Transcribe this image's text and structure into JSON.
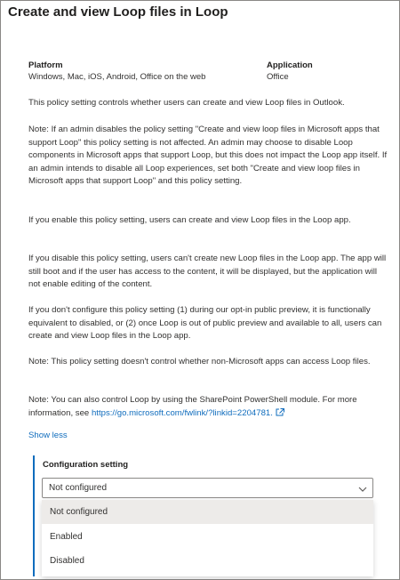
{
  "title": "Create and view Loop files in Loop",
  "meta": {
    "platform_label": "Platform",
    "platform_value": "Windows, Mac, iOS, Android, Office on the web",
    "application_label": "Application",
    "application_value": "Office"
  },
  "paragraphs": {
    "p1": "This policy setting controls whether users can create and view Loop files in Outlook.",
    "p2": "Note: If an admin disables the policy setting \"Create and view loop files in Microsoft apps that support Loop\" this policy setting is not affected. An admin may choose to disable Loop components in Microsoft apps that support Loop, but this does not impact the Loop app itself. If an admin intends to disable all Loop experiences, set both \"Create and view loop files in Microsoft apps that support Loop\" and this policy setting.",
    "p3": "If you enable this policy setting, users can create and view Loop files in the Loop app.",
    "p4": "If you disable this policy setting, users can't create new Loop files in the Loop app. The app will still boot and if the user has access to the content, it will be displayed, but the application will not enable editing of the content.",
    "p5": "If you don't configure this policy setting (1) during our opt-in public preview, it is functionally equivalent to disabled, or (2) once Loop is out of public preview and available to all, users can create and view Loop files in the Loop app.",
    "p6": "Note: This policy setting doesn't control whether non-Microsoft apps can access Loop files.",
    "p7_text": "Note: You can also control Loop by using the SharePoint PowerShell module. For more information, see ",
    "p7_link": "https://go.microsoft.com/fwlink/?linkid=2204781.",
    "p7_link_icon": "external-link-icon"
  },
  "show_less": "Show less",
  "config": {
    "label": "Configuration setting",
    "selected_value": "Not configured",
    "chevron_icon": "chevron-down-icon",
    "options": [
      "Not configured",
      "Enabled",
      "Disabled"
    ]
  },
  "colors": {
    "accent": "#0f6cbd",
    "text": "#323130",
    "selected_option_bg": "#edebe9",
    "border": "#8a8886"
  }
}
